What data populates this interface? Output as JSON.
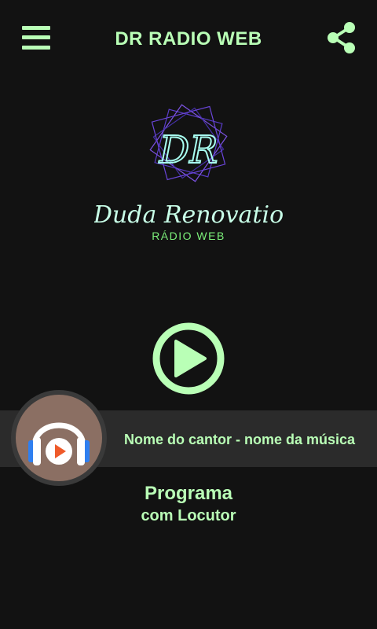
{
  "header": {
    "title": "DR RADIO WEB",
    "menu_icon": "menu-icon",
    "share_icon": "share-icon"
  },
  "logo": {
    "monogram": "DR",
    "script_name": "Duda Renovatio",
    "subtitle": "RÁDIO WEB"
  },
  "player": {
    "play_icon": "play-icon",
    "now_playing": "Nome do cantor - nome da música",
    "cover_icon": "headphones-play-icon"
  },
  "program": {
    "title": "Programa",
    "host": "com Locutor"
  },
  "colors": {
    "background": "#121212",
    "accent": "#b9ffb6",
    "bar": "#2b2b2b",
    "cover_bg": "#8b6f63"
  }
}
